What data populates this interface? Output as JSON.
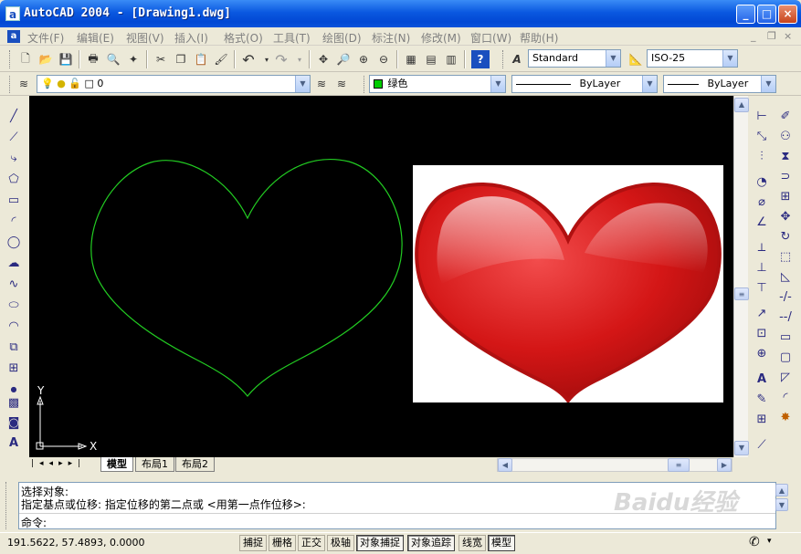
{
  "window": {
    "title": "AutoCAD 2004 - [Drawing1.dwg]",
    "icon": "a"
  },
  "menus": [
    "文件(F)",
    "编辑(E)",
    "视图(V)",
    "插入(I)",
    "格式(O)",
    "工具(T)",
    "绘图(D)",
    "标注(N)",
    "修改(M)",
    "窗口(W)",
    "帮助(H)"
  ],
  "styles": {
    "text_style": "Standard",
    "dim_style": "ISO-25"
  },
  "layers": {
    "current_layer": "0",
    "color": "绿色",
    "linetype": "ByLayer",
    "lineweight": "ByLayer"
  },
  "layout_tabs": [
    "模型",
    "布局1",
    "布局2"
  ],
  "ucs": {
    "y_label": "Y",
    "x_label": "X"
  },
  "command": {
    "history": [
      "选择对象:",
      "指定基点或位移: 指定位移的第二点或 <用第一点作位移>:"
    ],
    "prompt": "命令:"
  },
  "status": {
    "coordinates": "191.5622, 57.4893, 0.0000",
    "toggles": [
      "捕捉",
      "栅格",
      "正交",
      "极轴",
      "对象捕捉",
      "对象追踪",
      "线宽",
      "模型"
    ]
  },
  "colors": {
    "heart_outline": "#22cc22",
    "canvas_bg": "#000000",
    "color_swatch": "#00cc00"
  }
}
